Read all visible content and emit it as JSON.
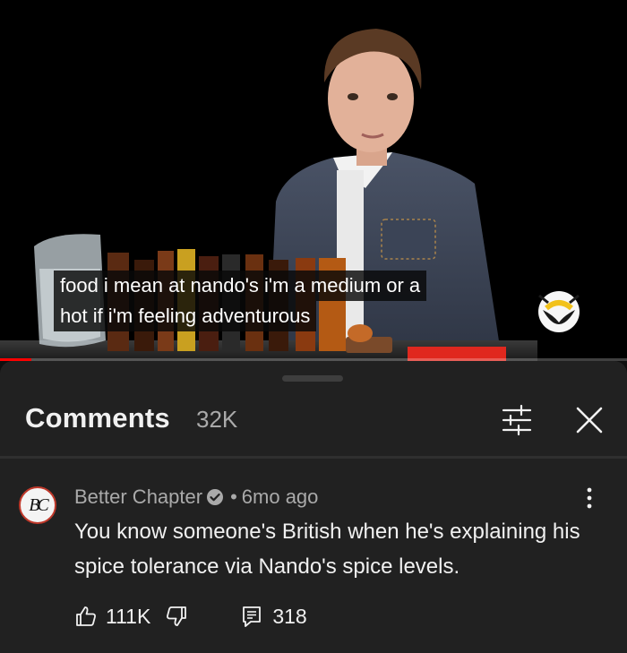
{
  "video": {
    "caption_lines": [
      "food i mean at nando's i'm a medium or a",
      "hot if i'm feeling adventurous"
    ],
    "progress_fraction": 0.05,
    "progress_color": "#ff0000"
  },
  "comments_panel": {
    "title": "Comments",
    "count": "32K",
    "filter_icon": "sliders-icon",
    "close_icon": "close-icon"
  },
  "comment": {
    "avatar_initials": "BC",
    "author": "Better Chapter",
    "verified": true,
    "separator": "•",
    "age": "6mo ago",
    "text": "You know someone's British when he's explaining his spice tolerance via Nando's spice levels.",
    "likes": "111K",
    "replies": "318",
    "icons": {
      "like": "thumbs-up-icon",
      "dislike": "thumbs-down-icon",
      "reply": "reply-icon",
      "more": "more-vert-icon"
    }
  },
  "colors": {
    "panel_bg": "#212121",
    "accent_red": "#ff0000",
    "secondary_text": "#aaaaaa"
  }
}
